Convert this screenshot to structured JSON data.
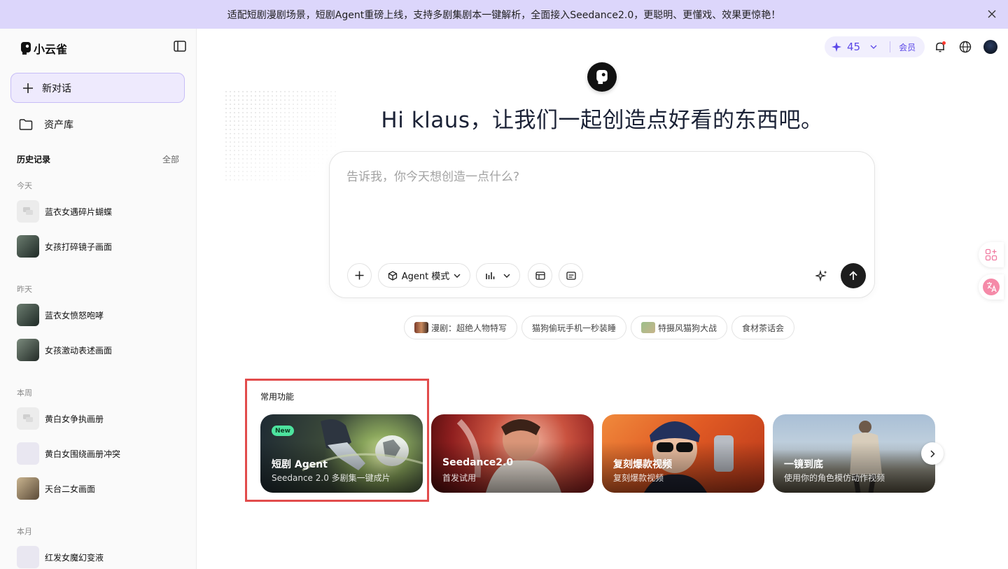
{
  "banner": {
    "text": "适配短剧漫剧场景，短剧Agent重磅上线，支持多剧集剧本一键解析，全面接入Seedance2.0，更聪明、更懂戏、效果更惊艳！"
  },
  "sidebar": {
    "logo_text": "小云雀",
    "new_chat_label": "新对话",
    "assets_label": "资产库",
    "history_title": "历史记录",
    "history_all": "全部",
    "groups": [
      {
        "label": "今天",
        "items": [
          {
            "label": "蓝衣女遇碎片蝴蝶",
            "thumb": "chat-icon"
          },
          {
            "label": "女孩打碎镜子画面",
            "thumb": "image"
          }
        ]
      },
      {
        "label": "昨天",
        "items": [
          {
            "label": "蓝衣女愤怒咆哮",
            "thumb": "image"
          },
          {
            "label": "女孩激动表述画面",
            "thumb": "image"
          }
        ]
      },
      {
        "label": "本周",
        "items": [
          {
            "label": "黄白女争执画册",
            "thumb": "chat-icon"
          },
          {
            "label": "黄白女围绕画册冲突",
            "thumb": "blank"
          },
          {
            "label": "天台二女画面",
            "thumb": "image"
          }
        ]
      },
      {
        "label": "本月",
        "items": [
          {
            "label": "红发女魔幻变液",
            "thumb": "blank"
          }
        ]
      }
    ]
  },
  "header": {
    "credits": "45",
    "vip_label": "会员"
  },
  "hero": {
    "title": "Hi klaus，让我们一起创造点好看的东西吧。"
  },
  "composer": {
    "placeholder": "告诉我，你今天想创造一点什么?",
    "mode_label": "Agent 模式"
  },
  "suggestions": [
    {
      "label": "漫剧：超绝人物特写",
      "thumb": true
    },
    {
      "label": "猫狗偷玩手机一秒装睡",
      "thumb": false
    },
    {
      "label": "特摄风猫狗大战",
      "thumb": true
    },
    {
      "label": "食材茶话会",
      "thumb": false
    }
  ],
  "features": {
    "title": "常用功能",
    "cards": [
      {
        "title": "短剧 Agent",
        "subtitle": "Seedance 2.0 多剧集一键成片",
        "badge": "New"
      },
      {
        "title": "Seedance2.0",
        "subtitle": "首发试用",
        "badge": ""
      },
      {
        "title": "复刻爆款视频",
        "subtitle": "复刻爆款视频",
        "badge": ""
      },
      {
        "title": "一镜到底",
        "subtitle": "使用你的角色模仿动作视频",
        "badge": ""
      }
    ]
  },
  "colors": {
    "accent": "#5b48e8",
    "banner_bg": "#dcd6fb",
    "focus_outline": "#e24c4c"
  }
}
